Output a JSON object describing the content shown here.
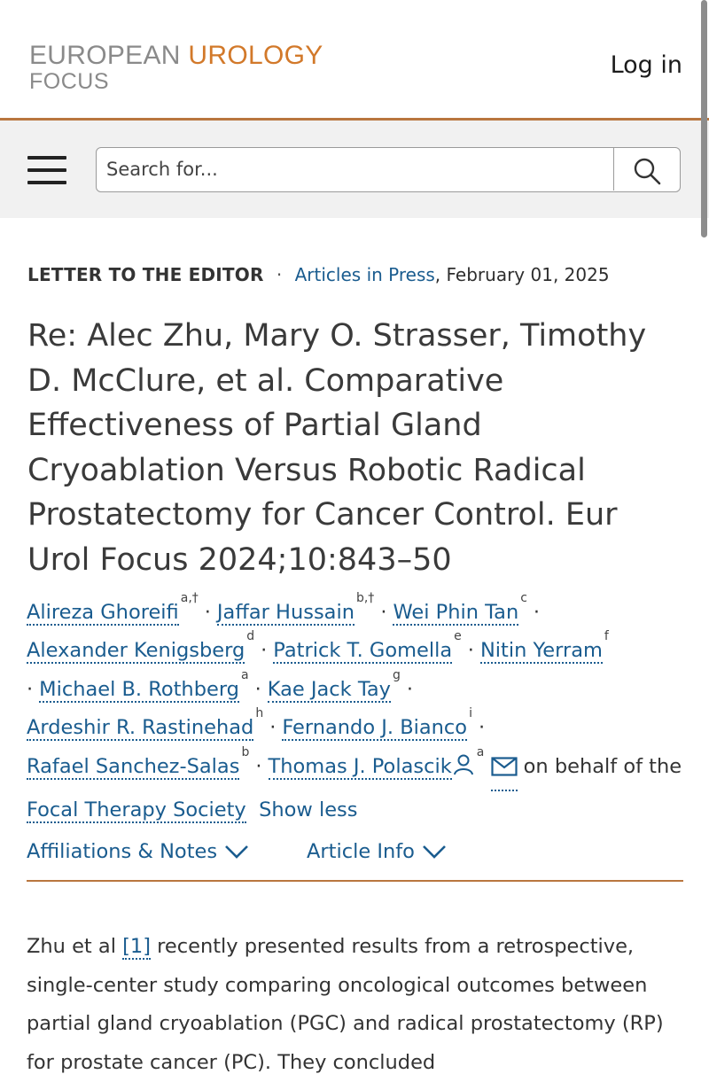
{
  "header": {
    "logo_word1": "EUROPEAN",
    "logo_word2": "UROLOGY",
    "logo_word3": "FOCUS",
    "login_label": "Log in"
  },
  "search": {
    "placeholder": "Search for...",
    "icon": "search-icon",
    "menu_icon": "hamburger-menu-icon"
  },
  "article": {
    "type": "LETTER TO THE EDITOR",
    "section": "Articles in Press",
    "date": ", February 01, 2025",
    "title": "Re: Alec Zhu, Mary O. Strasser, Timothy D. McClure, et al. Comparative Effectiveness of Partial Gland Cryoablation Versus Robotic Radical Prostatectomy for Cancer Control. Eur Urol Focus 2024;10:843–50",
    "authors": [
      {
        "name": "Alireza Ghoreifi",
        "sup": "a,†"
      },
      {
        "name": "Jaffar Hussain",
        "sup": "b,†"
      },
      {
        "name": "Wei Phin Tan",
        "sup": "c"
      },
      {
        "name": "Alexander Kenigsberg",
        "sup": "d"
      },
      {
        "name": "Patrick T. Gomella",
        "sup": "e"
      },
      {
        "name": "Nitin Yerram",
        "sup": "f"
      },
      {
        "name": "Michael B. Rothberg",
        "sup": "a"
      },
      {
        "name": "Kae Jack Tay",
        "sup": "g"
      },
      {
        "name": "Ardeshir R. Rastinehad",
        "sup": "h"
      },
      {
        "name": "Fernando J. Bianco",
        "sup": "i"
      },
      {
        "name": "Rafael Sanchez-Salas",
        "sup": "b"
      },
      {
        "name": "Thomas J. Polascik",
        "sup": "a"
      }
    ],
    "behalf_text": "on behalf of the",
    "group_name": "Focal Therapy Society",
    "show_less": "Show less",
    "affiliations_label": "Affiliations & Notes",
    "article_info_label": "Article Info",
    "body_intro": "Zhu et al",
    "body_ref": "[1]",
    "body_rest": "recently presented results from a retrospective, single-center study comparing oncological outcomes between partial gland cryoablation (PGC) and radical prostatectomy (RP) for prostate cancer (PC). They concluded"
  },
  "colors": {
    "accent_orange": "#d2792a",
    "link_blue": "#1a5c8f",
    "rule": "#b9763f"
  }
}
